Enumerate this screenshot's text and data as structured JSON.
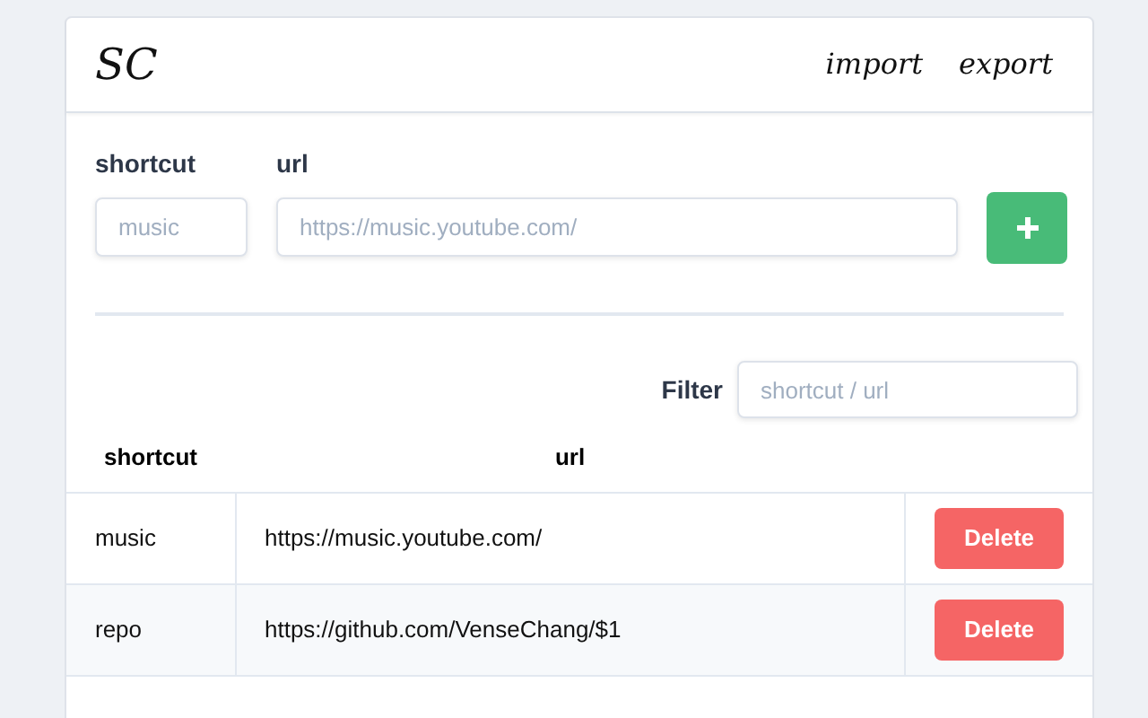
{
  "header": {
    "logo": "SC",
    "links": [
      "import",
      "export"
    ]
  },
  "form": {
    "shortcut_label": "shortcut",
    "url_label": "url",
    "shortcut_placeholder": "music",
    "url_placeholder": "https://music.youtube.com/"
  },
  "filter": {
    "label": "Filter",
    "placeholder": "shortcut / url"
  },
  "table": {
    "columns": [
      "shortcut",
      "url"
    ],
    "rows": [
      {
        "shortcut": "music",
        "url": "https://music.youtube.com/",
        "action": "Delete"
      },
      {
        "shortcut": "repo",
        "url": "https://github.com/VenseChang/$1",
        "action": "Delete"
      }
    ]
  }
}
